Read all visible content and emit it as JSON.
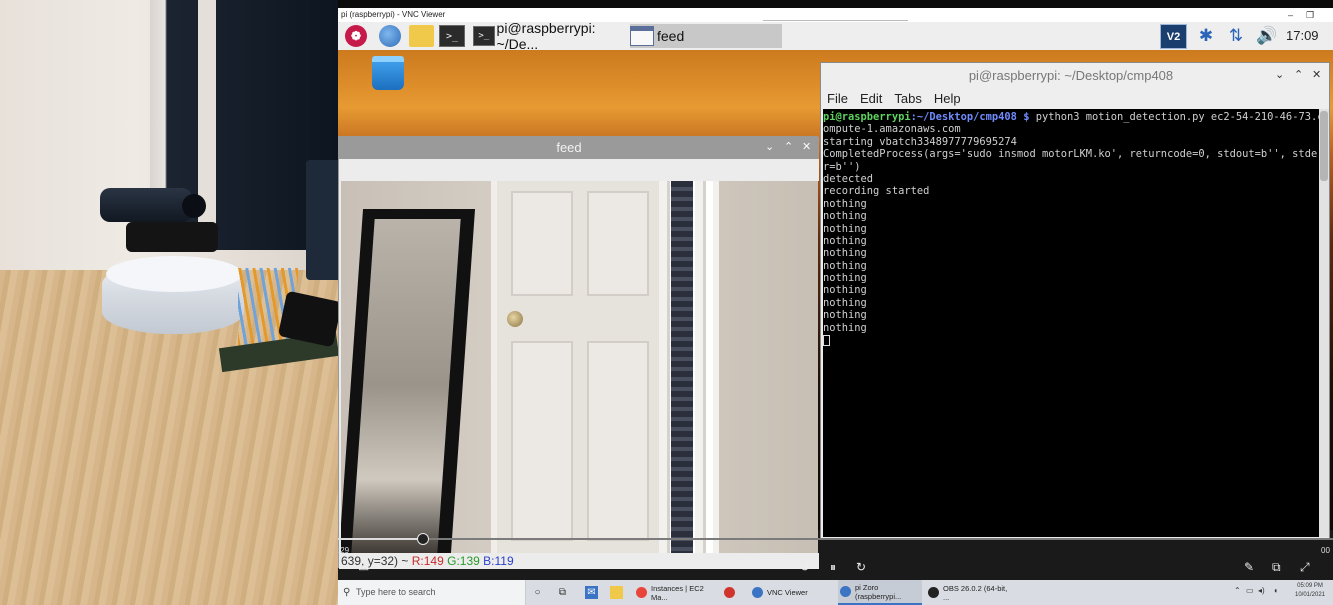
{
  "vnc_window": {
    "title": "pi (raspberrypi) - VNC Viewer",
    "minimize": "–",
    "restore": "❐"
  },
  "pi_taskbar": {
    "raspberry_glyph": "❁",
    "terminal_glyph": ">_",
    "tasks": [
      {
        "label": "pi@raspberrypi: ~/De..."
      },
      {
        "label": "feed"
      }
    ],
    "tray": {
      "vnc_glyph": "V2",
      "bluetooth_glyph": "✱",
      "network_glyph": "⇅",
      "volume_glyph": "🔊",
      "clock": "17:09"
    }
  },
  "feed_window": {
    "title": "feed",
    "controls": {
      "collapse": "⌄",
      "maximize": "⌃",
      "close": "✕"
    },
    "status": {
      "coords": "639, y=32) ~",
      "r": "R:149",
      "g": "G:139",
      "b": "B:119"
    }
  },
  "terminal_window": {
    "title": "pi@raspberrypi: ~/Desktop/cmp408",
    "controls": {
      "collapse": "⌄",
      "maximize": "⌃",
      "close": "✕"
    },
    "menu": [
      "File",
      "Edit",
      "Tabs",
      "Help"
    ],
    "prompt_user": "pi@raspberrypi",
    "prompt_path": ":~/Desktop/cmp408 $",
    "command": " python3 motion_detection.py ec2-54-210-46-73.c",
    "output": [
      "ompute-1.amazonaws.com",
      "starting vbatch3348977779695274",
      "CompletedProcess(args='sudo insmod motorLKM.ko', returncode=0, stdout=b'', stder",
      "r=b'')",
      "detected",
      "recording started",
      "nothing",
      "nothing",
      "nothing",
      "nothing",
      "nothing",
      "nothing",
      "nothing",
      "nothing",
      "nothing",
      "nothing",
      "nothing"
    ]
  },
  "player": {
    "time_left": ":29",
    "time_right": "00",
    "progress": 0.085,
    "buttons": {
      "captions": "▭",
      "rewind": "↺",
      "pause": "⏸",
      "forward": "↻",
      "edit": "✎",
      "pip": "⧉",
      "fullscreen": "⤢"
    }
  },
  "windows_taskbar": {
    "search_placeholder": "Type here to search",
    "apps": [
      {
        "label": "Instances | EC2 Ma...",
        "color": "#e8453c"
      },
      {
        "label": "",
        "color": "#d0342c"
      },
      {
        "label": "VNC Viewer",
        "color": "#3b74c4"
      },
      {
        "label": "pi Zoro (raspberrypi...",
        "color": "#3b74c4"
      },
      {
        "label": "OBS 26.0.2 (64-bit, ...",
        "color": "#222222"
      }
    ],
    "clock_time": "05:09 PM",
    "clock_date": "10/01/2021"
  }
}
